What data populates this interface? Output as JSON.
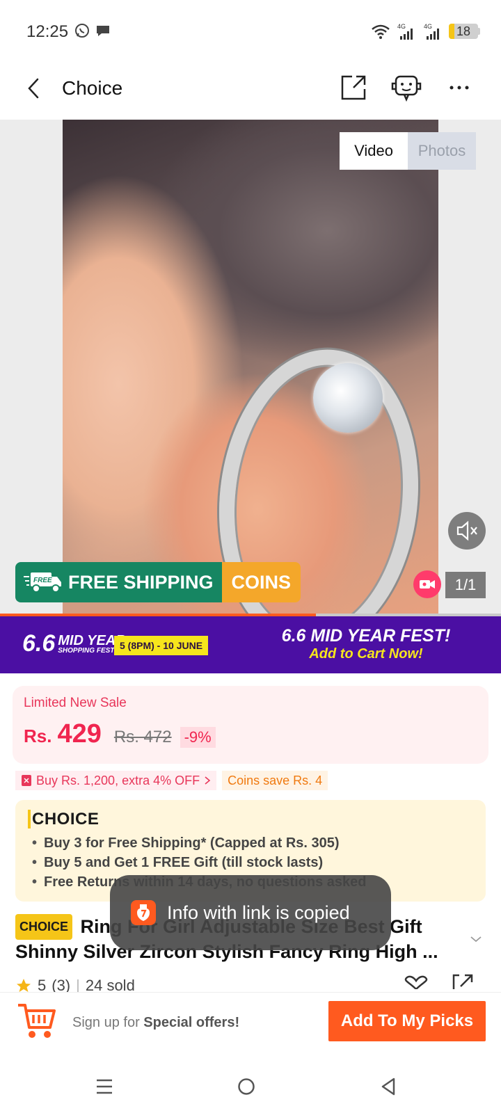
{
  "status_bar": {
    "time": "12:25",
    "network_1": "4G",
    "network_2": "4G",
    "battery_level": "18",
    "battery_fraction": 0.18
  },
  "header": {
    "title": "Choice",
    "back_icon": "back-arrow-icon",
    "share_icon": "share-icon",
    "support_icon": "chat-bot-icon",
    "more_icon": "more-icon"
  },
  "media": {
    "tabs": [
      {
        "label": "Video",
        "active": true
      },
      {
        "label": "Photos",
        "active": false
      }
    ],
    "counter": "1/1",
    "progress_fraction": 0.63,
    "shipping_banner": {
      "free_tag": "FREE",
      "text": "FREE SHIPPING",
      "coins": "COINS"
    }
  },
  "promo": {
    "logo_number": "6.6",
    "logo_line1": "MID YEAR",
    "logo_line2": "SHOPPING FEST!",
    "date": "5 (8PM) - 10 JUNE",
    "headline": "6.6 MID YEAR FEST!",
    "subline": "Add to Cart Now!"
  },
  "price": {
    "label": "Limited New Sale",
    "currency": "Rs.",
    "value": "429",
    "original": "Rs. 472",
    "discount": "-9%"
  },
  "vouchers": {
    "deal": "Buy Rs. 1,200, extra 4% OFF",
    "coins": "Coins save Rs. 4"
  },
  "choice": {
    "logo": "CHOICE",
    "items": [
      "Buy 3 for  Free Shipping* (Capped at Rs. 305)",
      "Buy 5 and Get 1 FREE Gift (till stock lasts)",
      "Free Returns within 14 days, no questions asked"
    ]
  },
  "product": {
    "badge": "CHOICE",
    "title": "Ring For Girl Adjustable Size Best Gift Shinny Silver Zircon Stylish Fancy Ring High ...",
    "rating": "5",
    "reviews": "(3)",
    "sold": "24 sold"
  },
  "toast": {
    "text": "Info with link is copied"
  },
  "bottom_bar": {
    "signup_prefix": "Sign up for ",
    "signup_bold": "Special offers!",
    "add_button": "Add To My Picks"
  },
  "colors": {
    "accent_orange": "#ff5a1f",
    "price_red": "#f0254f",
    "promo_purple": "#4b0fa3",
    "shipping_green": "#168662",
    "coins_orange": "#f4a72a",
    "choice_yellow": "#f5c518"
  }
}
